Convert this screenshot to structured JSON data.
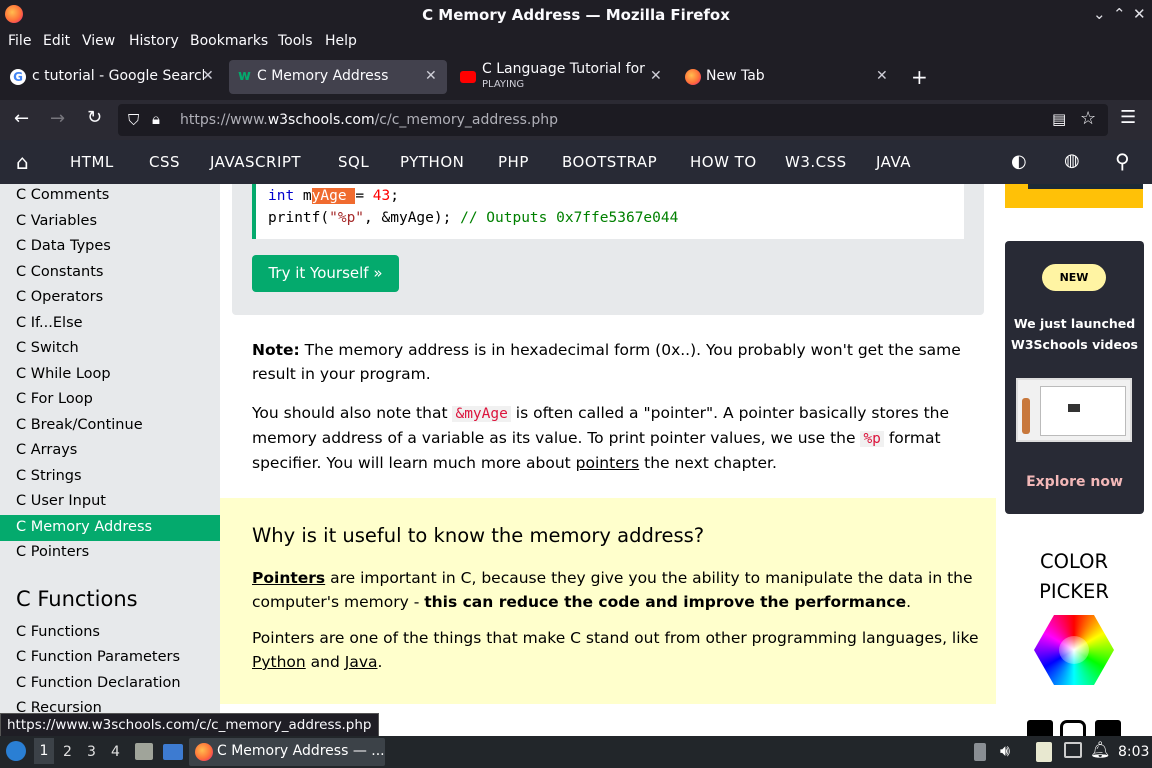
{
  "window": {
    "title": "C Memory Address — Mozilla Firefox"
  },
  "menu": [
    "File",
    "Edit",
    "View",
    "History",
    "Bookmarks",
    "Tools",
    "Help"
  ],
  "tabs": [
    {
      "label": "c tutorial - Google Search"
    },
    {
      "label": "C Memory Address"
    },
    {
      "label": "C Language Tutorial for B",
      "sub": "PLAYING"
    },
    {
      "label": "New Tab"
    }
  ],
  "url": {
    "prefix": "https://www.",
    "host": "w3schools.com",
    "path": "/c/c_memory_address.php"
  },
  "w3nav": [
    "HTML",
    "CSS",
    "JAVASCRIPT",
    "SQL",
    "PYTHON",
    "PHP",
    "BOOTSTRAP",
    "HOW TO",
    "W3.CSS",
    "JAVA"
  ],
  "sidebar": {
    "items": [
      "C Comments",
      "C Variables",
      "C Data Types",
      "C Constants",
      "C Operators",
      "C If...Else",
      "C Switch",
      "C While Loop",
      "C For Loop",
      "C Break/Continue",
      "C Arrays",
      "C Strings",
      "C User Input",
      "C Memory Address",
      "C Pointers"
    ],
    "section": "C Functions",
    "items2": [
      "C Functions",
      "C Function Parameters",
      "C Function Declaration",
      "C Recursion"
    ]
  },
  "code": {
    "line1": {
      "kw": "int",
      "pre": " m",
      "hl": "yAge ",
      "post": "= ",
      "num": "43",
      "end": ";"
    },
    "line2": {
      "fn": "printf(",
      "str": "\"%p\"",
      "mid": ", ",
      "arg": "&myAge",
      "close": "); ",
      "comment": "// Outputs 0x7ffe5367e044"
    }
  },
  "try_button": "Try it Yourself »",
  "note": {
    "bold": "Note:",
    "text1": " The memory address is in hexadecimal form (0x..). You probably won't get the same",
    "text2": "result in your program.",
    "p2a": "You should also note that ",
    "p2code": "&myAge",
    "p2b": " is often called a \"pointer\". A pointer basically stores the",
    "p2c": "memory address of a variable as its value. To print pointer values, we use the ",
    "p2code2": "%p",
    "p2d": " format",
    "p2e": "specifier. You will learn much more about ",
    "p2link": "pointers",
    "p2f": " the next chapter."
  },
  "why": {
    "heading": "Why is it useful to know the memory address?",
    "link": "Pointers",
    "t1": " are important in C, because they give you the ability to manipulate the data in the",
    "t2a": "computer's memory - ",
    "t2b": "this can reduce the code and improve the performance",
    "t2c": ".",
    "t3": "Pointers are one of the things that make C stand out from other programming languages, like",
    "python": "Python",
    "and": " and ",
    "java": "Java",
    "dot": "."
  },
  "ad": {
    "badge": "NEW",
    "line1": "We just launched",
    "line2": "W3Schools videos",
    "cta": "Explore now",
    "picker1": "COLOR",
    "picker2": "PICKER"
  },
  "status_url": "https://www.w3schools.com/c/c_memory_address.php",
  "taskbar": {
    "workspaces": [
      "1",
      "2",
      "3",
      "4"
    ],
    "task": "C Memory Address — ...",
    "clock": "8:03"
  }
}
